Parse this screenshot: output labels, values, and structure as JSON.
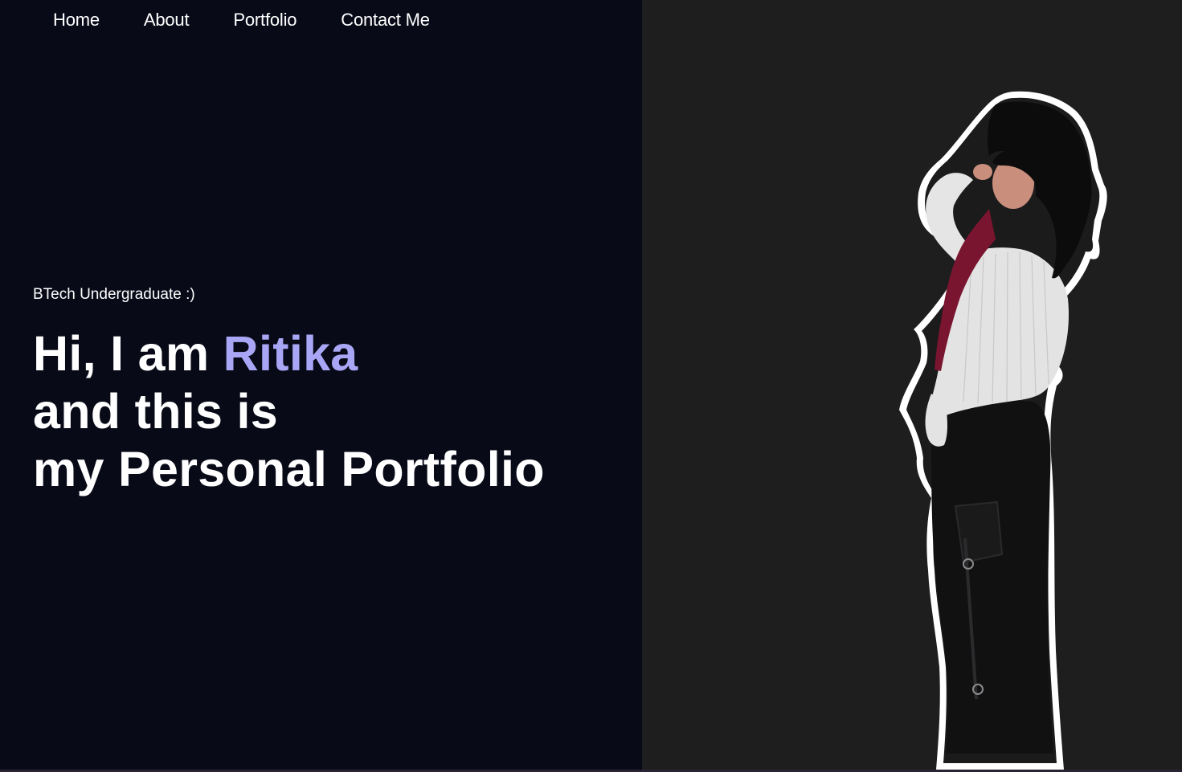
{
  "nav": {
    "home": "Home",
    "about": "About",
    "portfolio": "Portfolio",
    "contact": "Contact Me"
  },
  "hero": {
    "tagline": "BTech Undergraduate :)",
    "line1_prefix": "Hi, I am ",
    "name": "Ritika",
    "line2": "and this is",
    "line3": "my Personal Portfolio"
  },
  "colors": {
    "left_background": "#080a18",
    "right_background": "#1e1e1f",
    "name_accent": "#a9a7f5",
    "text": "#ffffff"
  },
  "image": {
    "icon": "portrait-cutout"
  }
}
